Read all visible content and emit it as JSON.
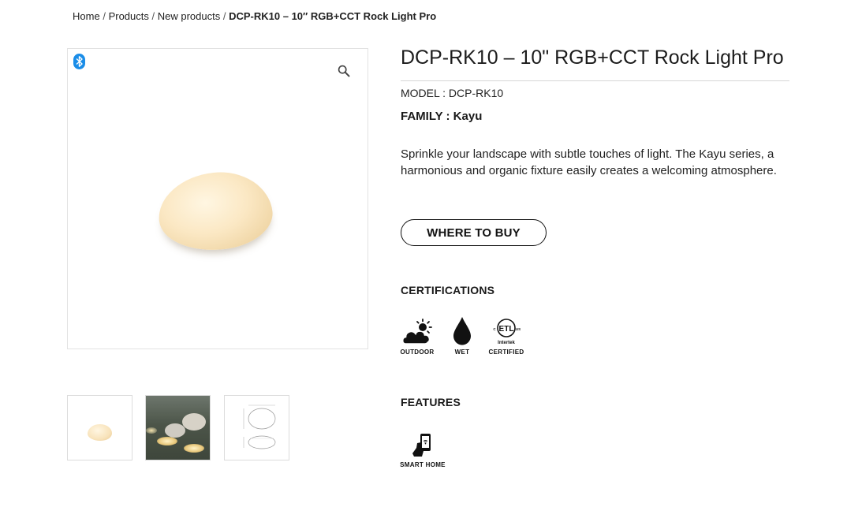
{
  "breadcrumb": {
    "items": [
      "Home",
      "Products",
      "New products"
    ],
    "separator": "/",
    "current": "DCP-RK10 – 10″ RGB+CCT Rock Light Pro"
  },
  "gallery": {
    "icons": {
      "badge": "bluetooth-icon",
      "zoom": "magnifier-icon"
    },
    "thumbnail_count": 3
  },
  "product": {
    "title": "DCP-RK10 – 10\" RGB+CCT Rock Light Pro",
    "model": "MODEL : DCP-RK10",
    "family": "FAMILY : Kayu",
    "description": "Sprinkle your landscape with subtle touches of light. The Kayu series, a harmonious and organic fixture easily creates a welcoming atmosphere.",
    "buy_button": "WHERE TO BUY"
  },
  "certifications": {
    "heading": "CERTIFICATIONS",
    "items": [
      {
        "label": "OUTDOOR",
        "icon": "cloud-sun-icon"
      },
      {
        "label": "WET",
        "icon": "water-drop-icon"
      },
      {
        "label": "CERTIFIED",
        "icon": "etl-intertek-icon",
        "icon_text": [
          "ETL",
          "US",
          "C",
          "Intertek"
        ]
      }
    ]
  },
  "features": {
    "heading": "FEATURES",
    "items": [
      {
        "label": "SMART HOME",
        "icon": "smartphone-hand-icon"
      }
    ]
  },
  "colors": {
    "bluetooth": "#1a8de8",
    "border": "#e2e2e2",
    "text": "#1a1a1a",
    "rock": "#fbe8c4"
  }
}
